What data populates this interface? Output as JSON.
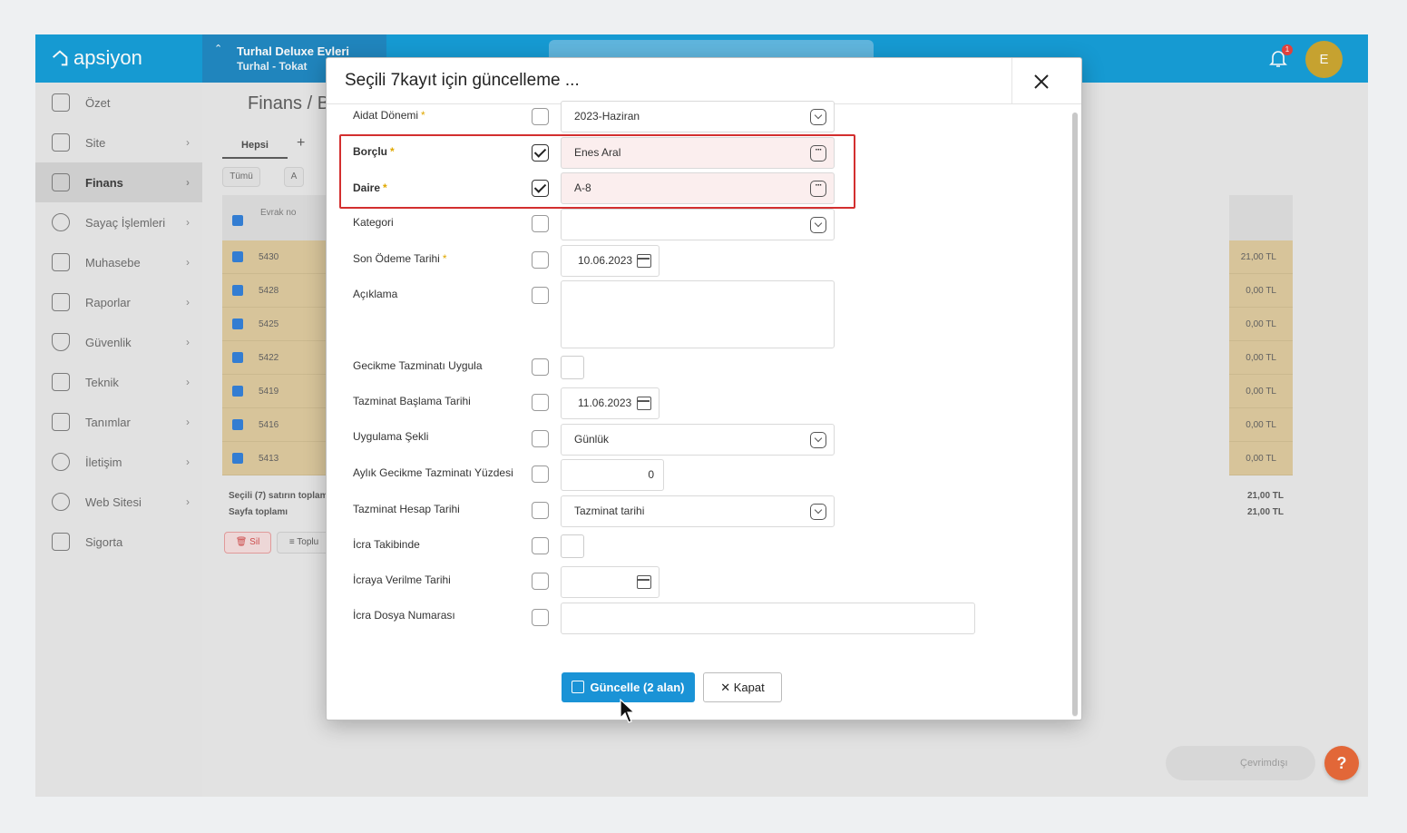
{
  "app": {
    "logo_text": "apsiyon",
    "site_name": "Turhal Deluxe Evleri",
    "site_location": "Turhal - Tokat",
    "notification_count": "1",
    "avatar_initial": "E",
    "brand_color": "#0a9ad6"
  },
  "sidebar": {
    "items": [
      {
        "label": "Özet",
        "icon": "table-icon"
      },
      {
        "label": "Site",
        "icon": "building-icon"
      },
      {
        "label": "Finans",
        "icon": "finance-icon"
      },
      {
        "label": "Sayaç İşlemleri",
        "icon": "gauge-icon"
      },
      {
        "label": "Muhasebe",
        "icon": "briefcase-icon"
      },
      {
        "label": "Raporlar",
        "icon": "chart-icon"
      },
      {
        "label": "Güvenlik",
        "icon": "shield-icon"
      },
      {
        "label": "Teknik",
        "icon": "tools-icon"
      },
      {
        "label": "Tanımlar",
        "icon": "grid-icon"
      },
      {
        "label": "İletişim",
        "icon": "chat-icon"
      },
      {
        "label": "Web Sitesi",
        "icon": "globe-icon"
      },
      {
        "label": "Sigorta",
        "icon": "insurance-icon"
      }
    ]
  },
  "main": {
    "breadcrumb": "Finans / B",
    "tab_all": "Hepsi",
    "tab_add": "+",
    "filter_all": "Tümü",
    "filter_a": "A",
    "columns": [
      "Evrak no"
    ],
    "rows": [
      {
        "no": "5430",
        "amount": "21,00 TL"
      },
      {
        "no": "5428",
        "amount": "0,00 TL"
      },
      {
        "no": "5425",
        "amount": "0,00 TL"
      },
      {
        "no": "5422",
        "amount": "0,00 TL"
      },
      {
        "no": "5419",
        "amount": "0,00 TL"
      },
      {
        "no": "5416",
        "amount": "0,00 TL"
      },
      {
        "no": "5413",
        "amount": "0,00 TL"
      }
    ],
    "selected_total_label": "Seçili (7) satırın toplam",
    "page_total_label": "Sayfa toplamı",
    "selected_total": "21,00 TL",
    "page_total": "21,00 TL",
    "delete_label": "Sil",
    "bulk_label": "Toplu",
    "offline_label": "Çevrimdışı",
    "help_label": "?"
  },
  "modal": {
    "title": "Seçili 7kayıt için güncelleme ...",
    "fields": [
      {
        "label": "Aidat Dönemi",
        "required": "*",
        "checked": false,
        "value": "2023-Haziran",
        "kind": "dropdown"
      },
      {
        "label": "Borçlu",
        "required": "*",
        "checked": true,
        "value": "Enes Aral",
        "kind": "picker"
      },
      {
        "label": "Daire",
        "required": "*",
        "checked": true,
        "value": "A-8",
        "kind": "picker"
      },
      {
        "label": "Kategori",
        "required": "",
        "checked": false,
        "value": "",
        "kind": "dropdown"
      },
      {
        "label": "Son Ödeme Tarihi",
        "required": "*",
        "checked": false,
        "value": "10.06.2023",
        "kind": "date"
      },
      {
        "label": "Açıklama",
        "required": "",
        "checked": false,
        "value": "",
        "kind": "textarea"
      },
      {
        "label": "Gecikme Tazminatı Uygula",
        "required": "",
        "checked": false,
        "value": "",
        "kind": "checkbox"
      },
      {
        "label": "Tazminat Başlama Tarihi",
        "required": "",
        "checked": false,
        "value": "11.06.2023",
        "kind": "date"
      },
      {
        "label": "Uygulama Şekli",
        "required": "",
        "checked": false,
        "value": "Günlük",
        "kind": "dropdown"
      },
      {
        "label": "Aylık Gecikme Tazminatı Yüzdesi",
        "required": "",
        "checked": false,
        "value": "0",
        "kind": "number"
      },
      {
        "label": "Tazminat Hesap Tarihi",
        "required": "",
        "checked": false,
        "value": "Tazminat tarihi",
        "kind": "dropdown"
      },
      {
        "label": "İcra Takibinde",
        "required": "",
        "checked": false,
        "value": "",
        "kind": "checkbox"
      },
      {
        "label": "İcraya Verilme Tarihi",
        "required": "",
        "checked": false,
        "value": "",
        "kind": "date"
      },
      {
        "label": "İcra Dosya Numarası",
        "required": "",
        "checked": false,
        "value": "",
        "kind": "text"
      }
    ],
    "update_button": "Güncelle (2 alan)",
    "close_button": "Kapat",
    "highlight_color": "#d32f2f",
    "primary_color": "#1a93d6"
  }
}
